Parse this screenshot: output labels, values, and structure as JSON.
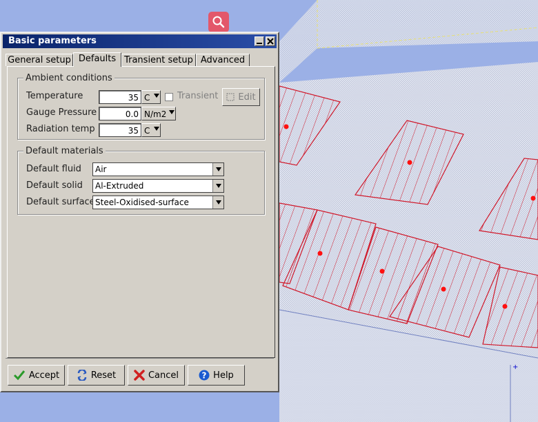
{
  "dialog": {
    "title": "Basic parameters",
    "tabs": [
      "General setup",
      "Defaults",
      "Transient setup",
      "Advanced"
    ],
    "active_tab": "Defaults"
  },
  "ambient": {
    "group_label": "Ambient conditions",
    "temperature_label": "Temperature",
    "temperature_value": "35",
    "temperature_unit": "C",
    "transient_label": "Transient",
    "edit_label": "Edit",
    "pressure_label": "Gauge Pressure",
    "pressure_value": "0.0",
    "pressure_unit": "N/m2",
    "radiation_label": "Radiation temp",
    "radiation_value": "35",
    "radiation_unit": "C"
  },
  "materials": {
    "group_label": "Default materials",
    "fluid_label": "Default fluid",
    "fluid_value": "Air",
    "solid_label": "Default solid",
    "solid_value": "Al-Extruded",
    "surface_label": "Default surface",
    "surface_value": "Steel-Oxidised-surface"
  },
  "buttons": {
    "accept": "Accept",
    "reset": "Reset",
    "cancel": "Cancel",
    "help": "Help"
  },
  "colors": {
    "title_bar": "#0a246a",
    "dialog_bg": "#d4d0c8",
    "viewport_bg": "#9bb0e6",
    "object_red": "#d0182a"
  }
}
